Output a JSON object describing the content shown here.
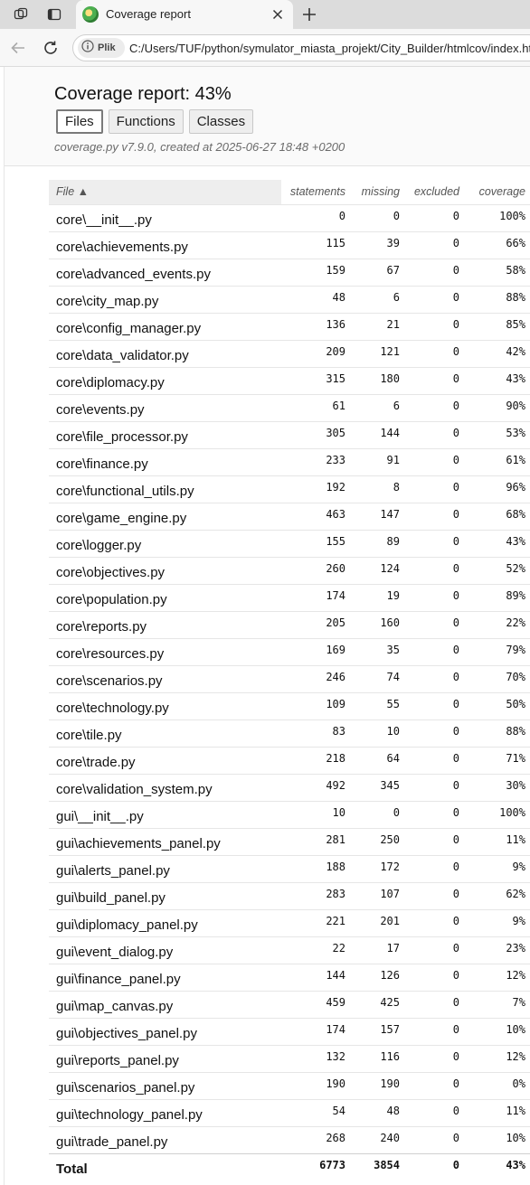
{
  "browser": {
    "tab_title": "Coverage report",
    "site_chip": "Plik",
    "url": "C:/Users/TUF/python/symulator_miasta_projekt/City_Builder/htmlcov/index.html"
  },
  "header": {
    "title": "Coverage report: 43%",
    "buttons": [
      "Files",
      "Functions",
      "Classes"
    ],
    "meta": "coverage.py v7.9.0, created at 2025-06-27 18:48 +0200"
  },
  "table": {
    "columns": [
      "File ▲",
      "statements",
      "missing",
      "excluded",
      "coverage"
    ],
    "rows": [
      {
        "file": "core\\__init__.py",
        "statements": "0",
        "missing": "0",
        "excluded": "0",
        "coverage": "100%"
      },
      {
        "file": "core\\achievements.py",
        "statements": "115",
        "missing": "39",
        "excluded": "0",
        "coverage": "66%"
      },
      {
        "file": "core\\advanced_events.py",
        "statements": "159",
        "missing": "67",
        "excluded": "0",
        "coverage": "58%"
      },
      {
        "file": "core\\city_map.py",
        "statements": "48",
        "missing": "6",
        "excluded": "0",
        "coverage": "88%"
      },
      {
        "file": "core\\config_manager.py",
        "statements": "136",
        "missing": "21",
        "excluded": "0",
        "coverage": "85%"
      },
      {
        "file": "core\\data_validator.py",
        "statements": "209",
        "missing": "121",
        "excluded": "0",
        "coverage": "42%"
      },
      {
        "file": "core\\diplomacy.py",
        "statements": "315",
        "missing": "180",
        "excluded": "0",
        "coverage": "43%"
      },
      {
        "file": "core\\events.py",
        "statements": "61",
        "missing": "6",
        "excluded": "0",
        "coverage": "90%"
      },
      {
        "file": "core\\file_processor.py",
        "statements": "305",
        "missing": "144",
        "excluded": "0",
        "coverage": "53%"
      },
      {
        "file": "core\\finance.py",
        "statements": "233",
        "missing": "91",
        "excluded": "0",
        "coverage": "61%"
      },
      {
        "file": "core\\functional_utils.py",
        "statements": "192",
        "missing": "8",
        "excluded": "0",
        "coverage": "96%"
      },
      {
        "file": "core\\game_engine.py",
        "statements": "463",
        "missing": "147",
        "excluded": "0",
        "coverage": "68%"
      },
      {
        "file": "core\\logger.py",
        "statements": "155",
        "missing": "89",
        "excluded": "0",
        "coverage": "43%"
      },
      {
        "file": "core\\objectives.py",
        "statements": "260",
        "missing": "124",
        "excluded": "0",
        "coverage": "52%"
      },
      {
        "file": "core\\population.py",
        "statements": "174",
        "missing": "19",
        "excluded": "0",
        "coverage": "89%"
      },
      {
        "file": "core\\reports.py",
        "statements": "205",
        "missing": "160",
        "excluded": "0",
        "coverage": "22%"
      },
      {
        "file": "core\\resources.py",
        "statements": "169",
        "missing": "35",
        "excluded": "0",
        "coverage": "79%"
      },
      {
        "file": "core\\scenarios.py",
        "statements": "246",
        "missing": "74",
        "excluded": "0",
        "coverage": "70%"
      },
      {
        "file": "core\\technology.py",
        "statements": "109",
        "missing": "55",
        "excluded": "0",
        "coverage": "50%"
      },
      {
        "file": "core\\tile.py",
        "statements": "83",
        "missing": "10",
        "excluded": "0",
        "coverage": "88%"
      },
      {
        "file": "core\\trade.py",
        "statements": "218",
        "missing": "64",
        "excluded": "0",
        "coverage": "71%"
      },
      {
        "file": "core\\validation_system.py",
        "statements": "492",
        "missing": "345",
        "excluded": "0",
        "coverage": "30%"
      },
      {
        "file": "gui\\__init__.py",
        "statements": "10",
        "missing": "0",
        "excluded": "0",
        "coverage": "100%"
      },
      {
        "file": "gui\\achievements_panel.py",
        "statements": "281",
        "missing": "250",
        "excluded": "0",
        "coverage": "11%"
      },
      {
        "file": "gui\\alerts_panel.py",
        "statements": "188",
        "missing": "172",
        "excluded": "0",
        "coverage": "9%"
      },
      {
        "file": "gui\\build_panel.py",
        "statements": "283",
        "missing": "107",
        "excluded": "0",
        "coverage": "62%"
      },
      {
        "file": "gui\\diplomacy_panel.py",
        "statements": "221",
        "missing": "201",
        "excluded": "0",
        "coverage": "9%"
      },
      {
        "file": "gui\\event_dialog.py",
        "statements": "22",
        "missing": "17",
        "excluded": "0",
        "coverage": "23%"
      },
      {
        "file": "gui\\finance_panel.py",
        "statements": "144",
        "missing": "126",
        "excluded": "0",
        "coverage": "12%"
      },
      {
        "file": "gui\\map_canvas.py",
        "statements": "459",
        "missing": "425",
        "excluded": "0",
        "coverage": "7%"
      },
      {
        "file": "gui\\objectives_panel.py",
        "statements": "174",
        "missing": "157",
        "excluded": "0",
        "coverage": "10%"
      },
      {
        "file": "gui\\reports_panel.py",
        "statements": "132",
        "missing": "116",
        "excluded": "0",
        "coverage": "12%"
      },
      {
        "file": "gui\\scenarios_panel.py",
        "statements": "190",
        "missing": "190",
        "excluded": "0",
        "coverage": "0%"
      },
      {
        "file": "gui\\technology_panel.py",
        "statements": "54",
        "missing": "48",
        "excluded": "0",
        "coverage": "11%"
      },
      {
        "file": "gui\\trade_panel.py",
        "statements": "268",
        "missing": "240",
        "excluded": "0",
        "coverage": "10%"
      }
    ],
    "total": {
      "file": "Total",
      "statements": "6773",
      "missing": "3854",
      "excluded": "0",
      "coverage": "43%"
    }
  }
}
